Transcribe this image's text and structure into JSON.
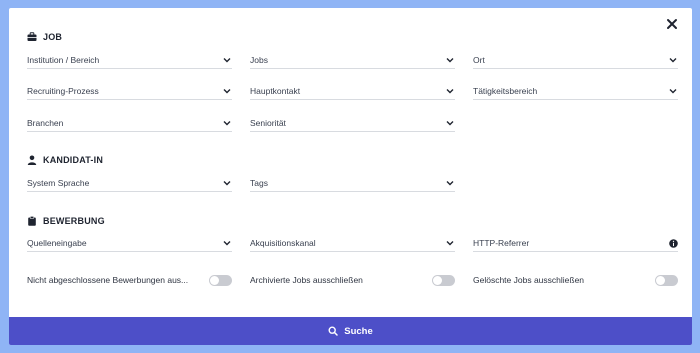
{
  "close_icon": "close-icon",
  "sections": {
    "job": {
      "title": "JOB",
      "icon": "briefcase-icon"
    },
    "kandidat": {
      "title": "KANDIDAT-IN",
      "icon": "person-icon"
    },
    "bewerbung": {
      "title": "BEWERBUNG",
      "icon": "clipboard-icon"
    }
  },
  "job_fields": [
    {
      "label": "Institution / Bereich"
    },
    {
      "label": "Jobs"
    },
    {
      "label": "Ort"
    },
    {
      "label": "Recruiting-Prozess"
    },
    {
      "label": "Hauptkontakt"
    },
    {
      "label": "Tätigkeitsbereich"
    },
    {
      "label": "Branchen"
    },
    {
      "label": "Seniorität"
    }
  ],
  "kandidat_fields": [
    {
      "label": "System Sprache"
    },
    {
      "label": "Tags"
    }
  ],
  "bewerbung_fields": [
    {
      "label": "Quelleneingabe"
    },
    {
      "label": "Akquisitionskanal"
    },
    {
      "label": "HTTP-Referrer"
    }
  ],
  "toggles": [
    {
      "label": "Nicht abgeschlossene Bewerbungen aus...",
      "on": false
    },
    {
      "label": "Archivierte Jobs ausschließen",
      "on": false
    },
    {
      "label": "Gelöschte Jobs ausschließen",
      "on": false
    }
  ],
  "search_button": {
    "label": "Suche",
    "icon": "search-icon"
  },
  "colors": {
    "accent": "#4d4fc8",
    "backdrop": "#8fb4f5",
    "toggle_off": "#c9cbd1"
  }
}
